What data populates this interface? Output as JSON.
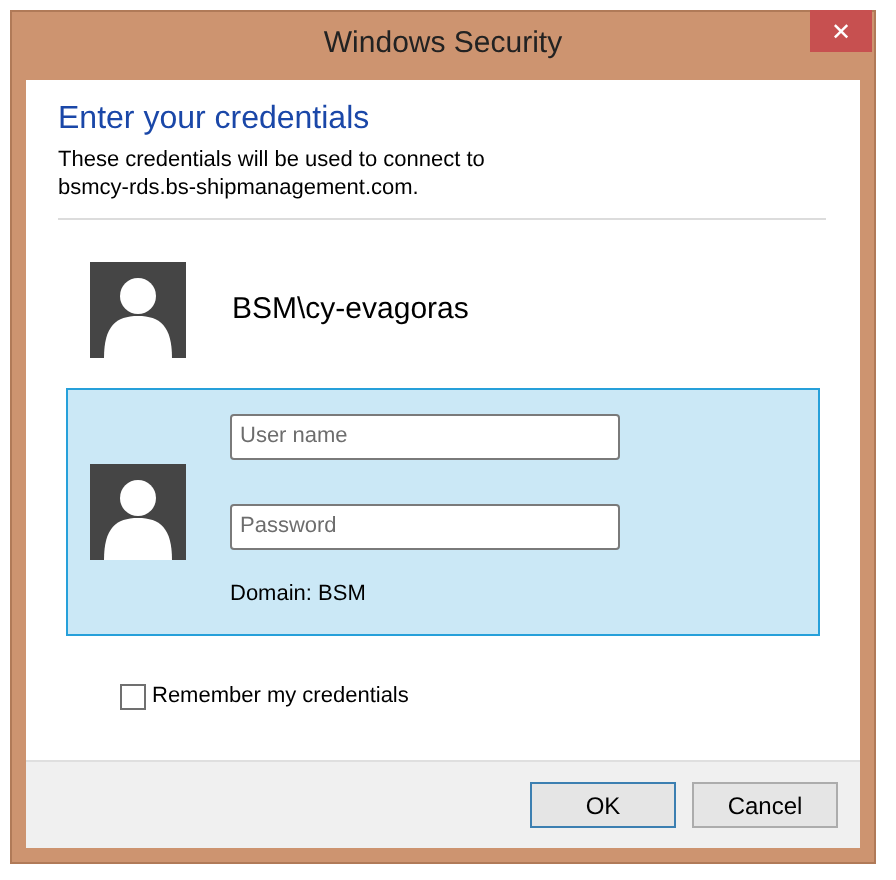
{
  "window": {
    "title": "Windows Security",
    "close": "✕"
  },
  "heading": "Enter your credentials",
  "message_lines": [
    "These credentials will be used to connect to",
    "bsmcy-rds.bs-shipmanagement.com."
  ],
  "accounts": [
    {
      "kind": "user",
      "name": "BSM\\cy-evagoras",
      "selected": false
    },
    {
      "kind": "credentials",
      "fields": [
        {
          "placeholder": "User name"
        },
        {
          "placeholder": "Password"
        }
      ],
      "domain": "Domain: BSM",
      "selected": true
    }
  ],
  "remember": {
    "label": "Remember my credentials",
    "checked": false
  },
  "buttons": [
    {
      "label": "OK",
      "default": true
    },
    {
      "label": "Cancel",
      "default": false
    }
  ]
}
